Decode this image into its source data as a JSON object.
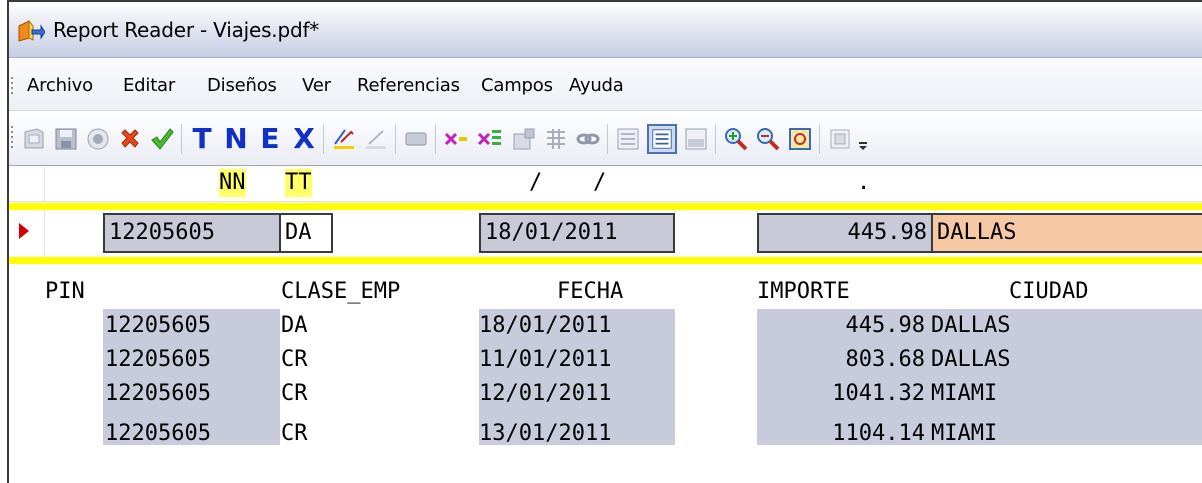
{
  "window": {
    "title": "Report Reader - Viajes.pdf*"
  },
  "menu": [
    "Archivo",
    "Editar",
    "Diseños",
    "Ver",
    "Referencias",
    "Campos",
    "Ayuda"
  ],
  "toolbar": {
    "letters": {
      "t": "T",
      "n": "N",
      "e": "E",
      "x": "X"
    }
  },
  "mask": {
    "nn": "NN",
    "tt": "TT",
    "slash1": "/",
    "slash2": "/",
    "dot": "."
  },
  "extracted": {
    "pin": "12205605",
    "clase": "DA",
    "fecha": "18/01/2011",
    "importe": "445.98",
    "ciudad": "DALLAS"
  },
  "report": {
    "columns": [
      "PIN",
      "CLASE_EMP",
      "FECHA",
      "IMPORTE",
      "CIUDAD"
    ],
    "rows": [
      [
        "12205605",
        "DA",
        "18/01/2011",
        "445.98",
        "DALLAS"
      ],
      [
        "12205605",
        "CR",
        "11/01/2011",
        "803.68",
        "DALLAS"
      ],
      [
        "12205605",
        "CR",
        "12/01/2011",
        "1041.32",
        "MIAMI"
      ],
      [
        "12205605",
        "CR",
        "13/01/2011",
        "1104.14",
        "MIAMI"
      ]
    ]
  },
  "colors": {
    "highlight_yellow": "#ffff00",
    "field_gray": "#c8cad8",
    "field_orange": "#f6c8a4",
    "arrow_red": "#d40000"
  }
}
